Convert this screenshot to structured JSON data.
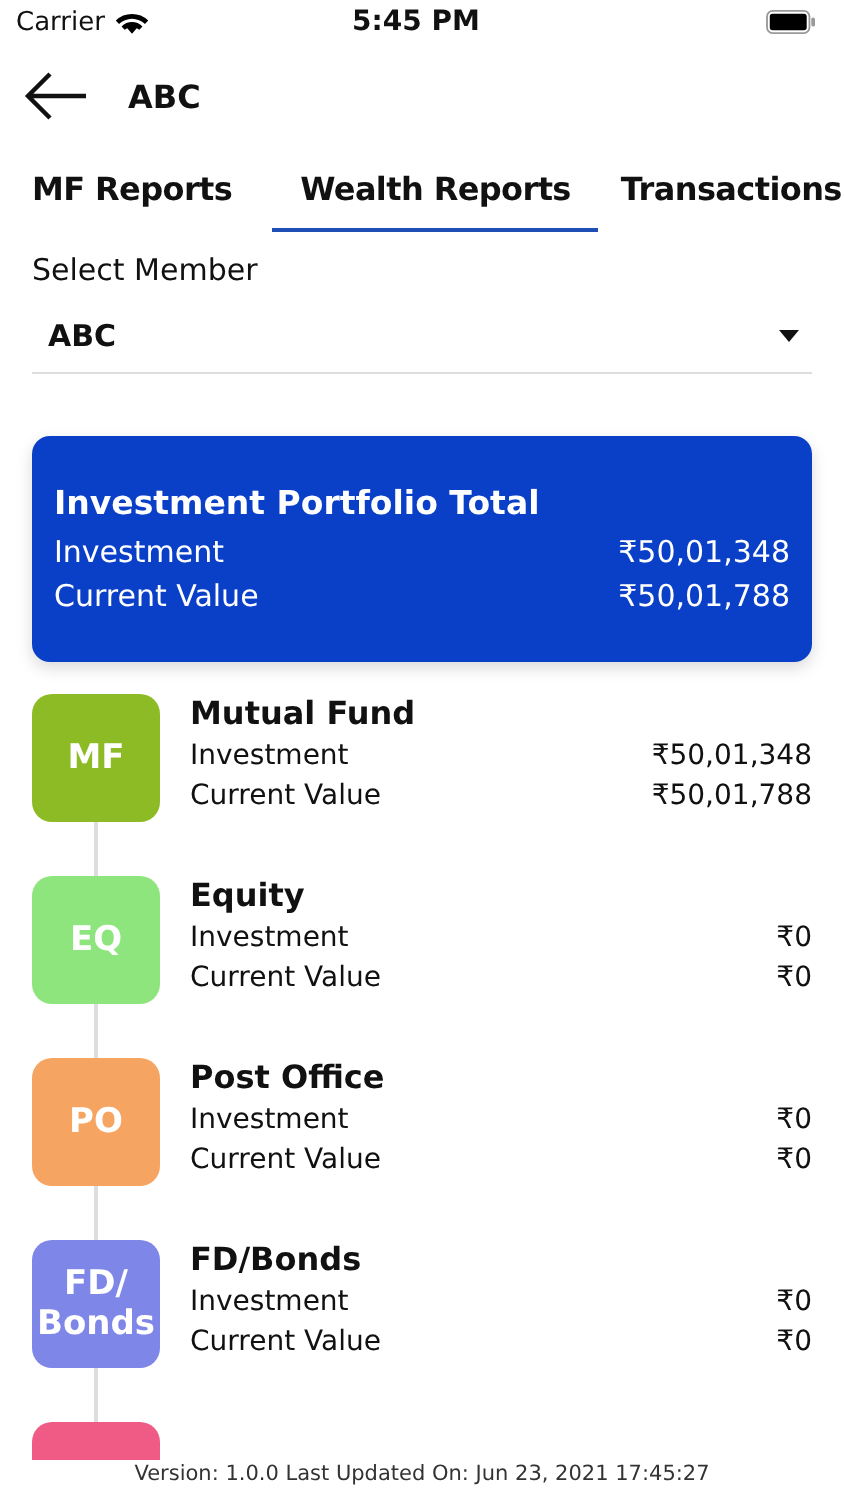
{
  "status_bar": {
    "carrier": "Carrier",
    "time": "5:45 PM"
  },
  "header": {
    "title": "ABC"
  },
  "tabs": [
    {
      "label": "MF Reports",
      "selected": false
    },
    {
      "label": "Wealth Reports",
      "selected": true
    },
    {
      "label": "Transactions",
      "selected": false
    }
  ],
  "member": {
    "label": "Select Member",
    "value": "ABC"
  },
  "total": {
    "title": "Investment Portfolio Total",
    "rows": [
      {
        "label": "Investment",
        "value": "₹50,01,348"
      },
      {
        "label": "Current Value",
        "value": "₹50,01,788"
      }
    ]
  },
  "assets": [
    {
      "badge": "MF",
      "color": "#8dbb25",
      "name": "Mutual Fund",
      "rows": [
        {
          "label": "Investment",
          "value": "₹50,01,348"
        },
        {
          "label": "Current Value",
          "value": "₹50,01,788"
        }
      ]
    },
    {
      "badge": "EQ",
      "color": "#8ee57e",
      "name": "Equity",
      "rows": [
        {
          "label": "Investment",
          "value": "₹0"
        },
        {
          "label": "Current Value",
          "value": "₹0"
        }
      ]
    },
    {
      "badge": "PO",
      "color": "#f5a462",
      "name": "Post Office",
      "rows": [
        {
          "label": "Investment",
          "value": "₹0"
        },
        {
          "label": "Current Value",
          "value": "₹0"
        }
      ]
    },
    {
      "badge": "FD/ Bonds",
      "color": "#7e86e8",
      "name": "FD/Bonds",
      "rows": [
        {
          "label": "Investment",
          "value": "₹0"
        },
        {
          "label": "Current Value",
          "value": "₹0"
        }
      ]
    },
    {
      "color": "#ef5b84"
    }
  ],
  "footer": "Version: 1.0.0 Last Updated On: Jun 23, 2021 17:45:27"
}
